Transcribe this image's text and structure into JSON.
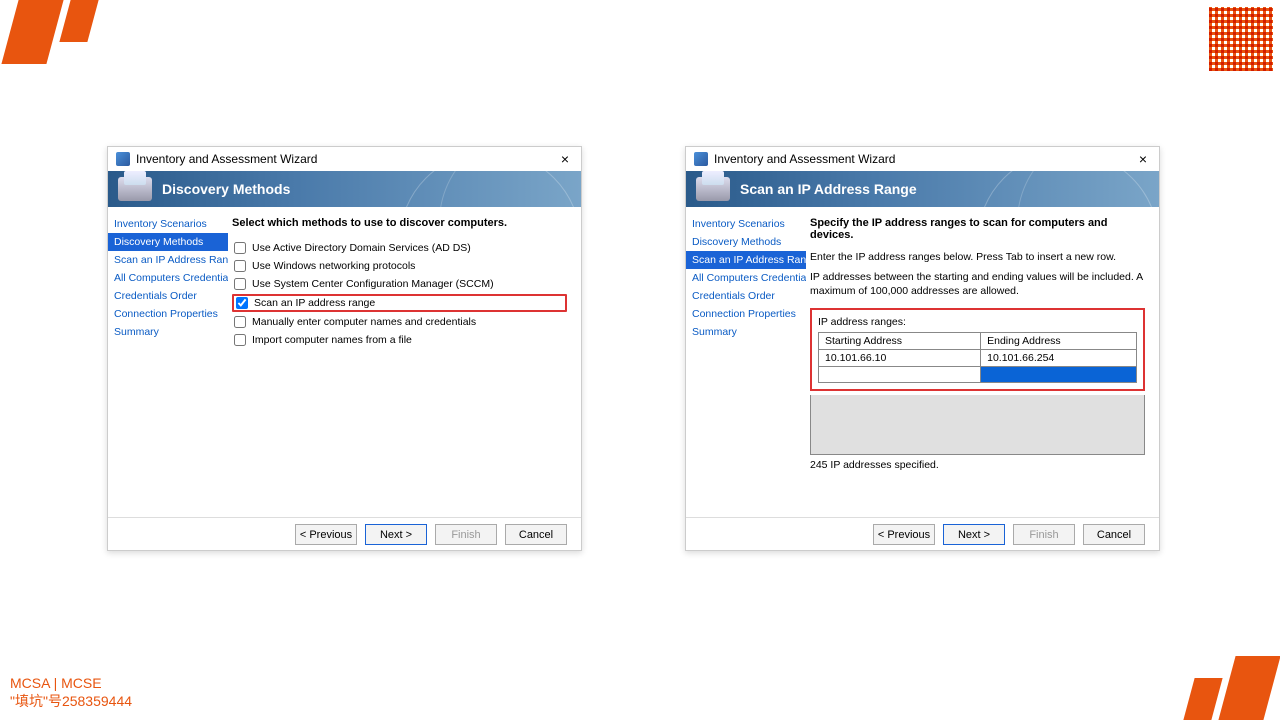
{
  "decor": {
    "footer_line1": "MCSA | MCSE",
    "footer_line2": "\"填坑\"号258359444"
  },
  "wizard_title": "Inventory and Assessment Wizard",
  "nav": {
    "items": [
      "Inventory Scenarios",
      "Discovery Methods",
      "Scan an IP Address Range",
      "All Computers Credentials",
      "Credentials Order",
      "Connection Properties",
      "Summary"
    ]
  },
  "buttons": {
    "prev": "< Previous",
    "next": "Next >",
    "finish": "Finish",
    "cancel": "Cancel"
  },
  "left": {
    "header": "Discovery Methods",
    "heading": "Select which methods to use to discover computers.",
    "selected_nav_index": 1,
    "options": [
      {
        "label": "Use Active Directory Domain Services (AD DS)",
        "checked": false
      },
      {
        "label": "Use Windows networking protocols",
        "checked": false
      },
      {
        "label": "Use System Center Configuration Manager (SCCM)",
        "checked": false
      },
      {
        "label": "Scan an IP address range",
        "checked": true,
        "highlight": true
      },
      {
        "label": "Manually enter computer names and credentials",
        "checked": false
      },
      {
        "label": "Import computer names from a file",
        "checked": false
      }
    ]
  },
  "right": {
    "header": "Scan an IP Address Range",
    "heading": "Specify the IP address ranges to scan for computers and devices.",
    "instruction": "Enter the IP address ranges below. Press Tab to insert a new row.",
    "note": "IP addresses between the starting and ending values will be included. A maximum of 100,000 addresses are allowed.",
    "selected_nav_index": 2,
    "ip_label": "IP address ranges:",
    "columns": {
      "start": "Starting Address",
      "end": "Ending Address"
    },
    "rows": [
      {
        "start": "10.101.66.10",
        "end": "10.101.66.254"
      }
    ],
    "count_text": "245 IP addresses specified."
  }
}
